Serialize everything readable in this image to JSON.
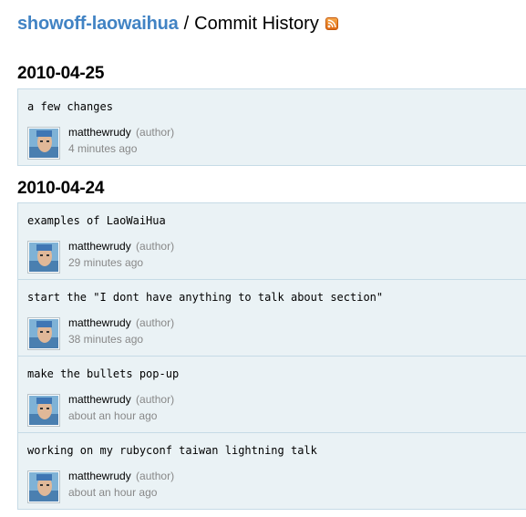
{
  "header": {
    "repo_name": "showoff-laowaihua",
    "separator": "/",
    "title": "Commit History",
    "rss_icon": "rss-feed-icon"
  },
  "groups": [
    {
      "date": "2010-04-25",
      "commits": [
        {
          "message": "a few changes",
          "author": "matthewrudy",
          "role": "(author)",
          "time": "4 minutes ago"
        }
      ]
    },
    {
      "date": "2010-04-24",
      "commits": [
        {
          "message": "examples of LaoWaiHua",
          "author": "matthewrudy",
          "role": "(author)",
          "time": "29 minutes ago"
        },
        {
          "message": "start the \"I dont have anything to talk about section\"",
          "author": "matthewrudy",
          "role": "(author)",
          "time": "38 minutes ago"
        },
        {
          "message": "make the bullets pop-up",
          "author": "matthewrudy",
          "role": "(author)",
          "time": "about an hour ago"
        },
        {
          "message": "working on my rubyconf taiwan lightning talk",
          "author": "matthewrudy",
          "role": "(author)",
          "time": "about an hour ago"
        }
      ]
    }
  ]
}
